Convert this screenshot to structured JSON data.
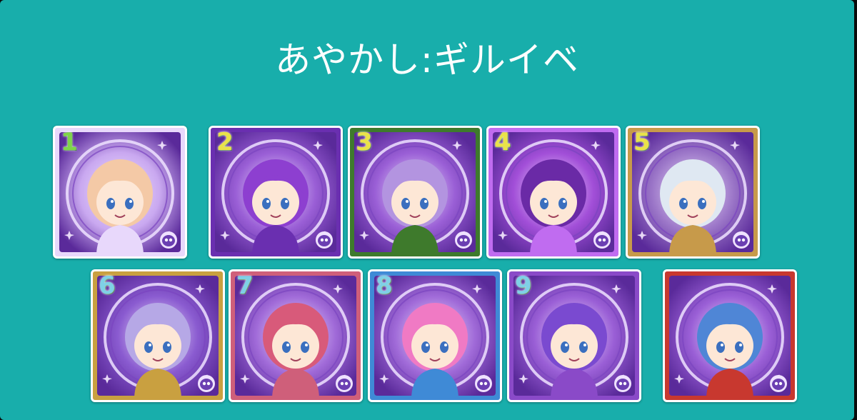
{
  "title": "あやかし:ギルイベ",
  "cards": [
    {
      "number": "1",
      "element": "purple",
      "theme": "#c9a8f0",
      "accent": "#e8d8fb",
      "hair": "#f4c9a6",
      "num_color": "#7fd34a"
    },
    {
      "number": "2",
      "element": "purple",
      "theme": "#9a5fd6",
      "accent": "#6a2fb0",
      "hair": "#8d3fd0",
      "num_color": "#e9e24a"
    },
    {
      "number": "3",
      "element": "purple",
      "theme": "#9a5fd6",
      "accent": "#3e7a2c",
      "hair": "#b394e0",
      "num_color": "#e9e24a"
    },
    {
      "number": "4",
      "element": "purple",
      "theme": "#a24fd8",
      "accent": "#c06cf0",
      "hair": "#6a2aa6",
      "num_color": "#e9e24a"
    },
    {
      "number": "5",
      "element": "purple",
      "theme": "#9d78c9",
      "accent": "#c79a4a",
      "hair": "#dfe8f2",
      "num_color": "#e9e24a"
    },
    {
      "number": "6",
      "element": "purple",
      "theme": "#8a5bd0",
      "accent": "#c9a040",
      "hair": "#b6a8e6",
      "num_color": "#7fd0e6"
    },
    {
      "number": "7",
      "element": "purple",
      "theme": "#a06ad8",
      "accent": "#cf5f7a",
      "hair": "#d85a7a",
      "num_color": "#7fd0e6"
    },
    {
      "number": "8",
      "element": "purple",
      "theme": "#a06ad8",
      "accent": "#3f8ad6",
      "hair": "#f07ac4",
      "num_color": "#7fd0e6"
    },
    {
      "number": "9",
      "element": "purple",
      "theme": "#9a5fd6",
      "accent": "#8a4ac8",
      "hair": "#7a4ad0",
      "num_color": "#7fd0e6"
    },
    {
      "number": "",
      "element": "purple",
      "theme": "#9a5fd6",
      "accent": "#c8382f",
      "hair": "#4f86d6",
      "num_color": "#7fd0e6"
    }
  ]
}
